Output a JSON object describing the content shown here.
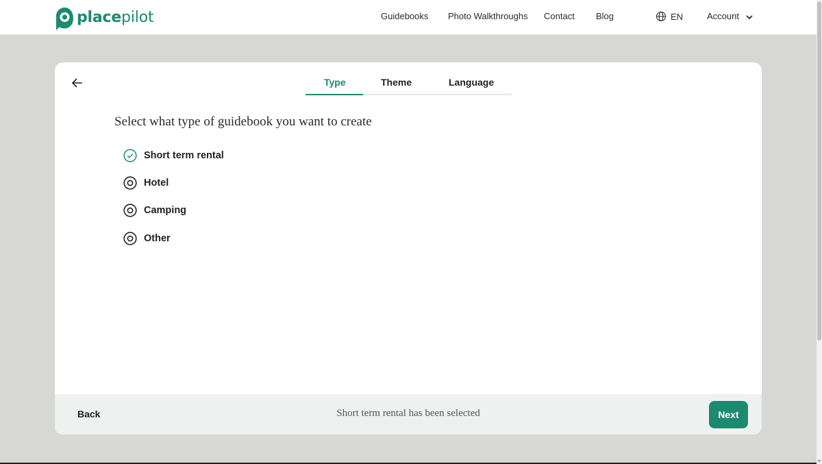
{
  "brand": {
    "name_part1": "place",
    "name_part2": "pilot",
    "accent_color": "#1b8a6f"
  },
  "nav": {
    "links": [
      "Guidebooks",
      "Photo Walkthroughs",
      "Contact",
      "Blog"
    ],
    "language": "EN",
    "account": "Account"
  },
  "wizard": {
    "tabs": [
      {
        "label": "Type",
        "active": true
      },
      {
        "label": "Theme",
        "active": false
      },
      {
        "label": "Language",
        "active": false
      }
    ],
    "question": "Select what type of guidebook you want to create",
    "options": [
      {
        "label": "Short term rental",
        "selected": true
      },
      {
        "label": "Hotel",
        "selected": false
      },
      {
        "label": "Camping",
        "selected": false
      },
      {
        "label": "Other",
        "selected": false
      }
    ],
    "footer": {
      "back_label": "Back",
      "status": "Short term rental has been selected",
      "next_label": "Next"
    }
  }
}
